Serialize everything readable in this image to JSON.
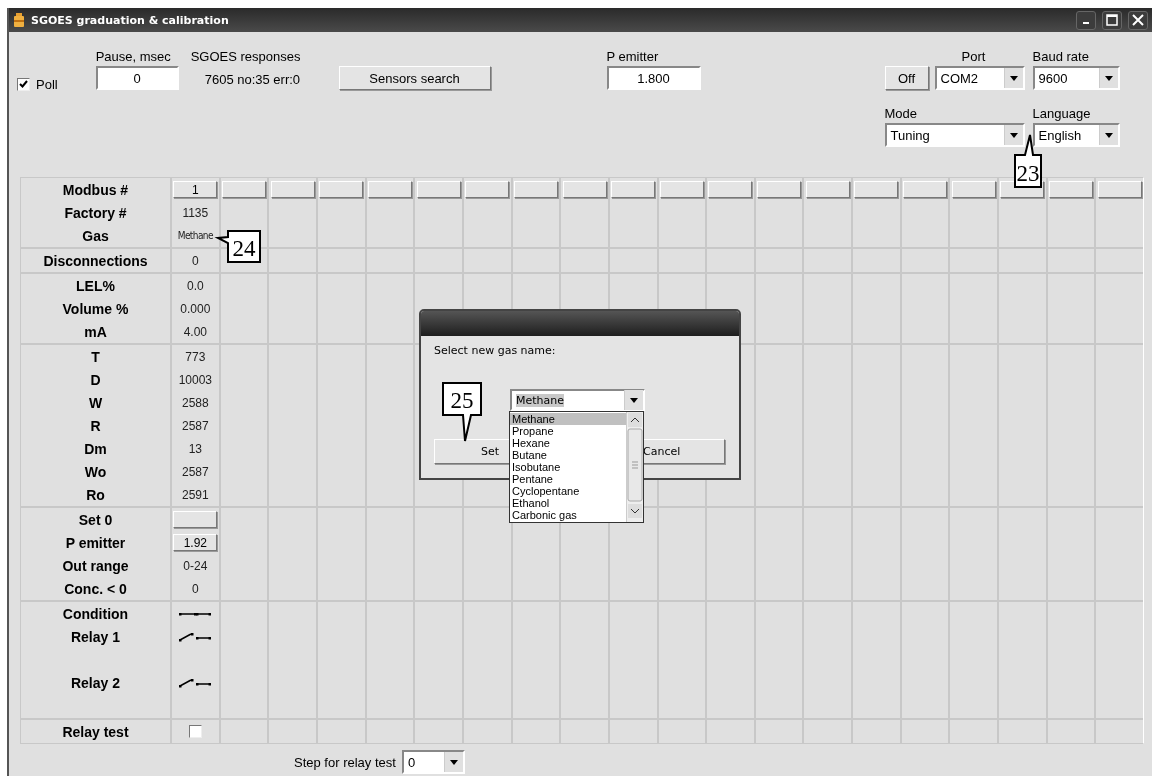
{
  "window": {
    "title": "SGOES  graduation & calibration"
  },
  "top": {
    "poll": {
      "label": "Poll",
      "checked": true
    },
    "pause": {
      "label": "Pause, msec",
      "value": "0"
    },
    "responses": {
      "label": "SGOES responses",
      "value": "7605 no:35 err:0"
    },
    "search_button": "Sensors search",
    "p_emitter": {
      "label": "P emitter",
      "value": "1.800"
    },
    "port": {
      "label": "Port",
      "off_button": "Off",
      "value": "COM2"
    },
    "baud": {
      "label": "Baud rate",
      "value": "9600"
    },
    "mode": {
      "label": "Mode",
      "value": "Tuning"
    },
    "language": {
      "label": "Language",
      "value": "English"
    }
  },
  "table": {
    "groups": [
      {
        "kind": "plain",
        "rows": [
          {
            "label": "Modbus #",
            "kind": "header-button",
            "value": "1"
          },
          {
            "label": "Factory #",
            "kind": "text",
            "value": "1135"
          },
          {
            "label": "Gas",
            "kind": "small-text",
            "value": "Methane"
          }
        ]
      },
      {
        "kind": "plain",
        "rows": [
          {
            "label": "Disconnections",
            "kind": "text",
            "value": "0"
          }
        ]
      },
      {
        "kind": "plain",
        "rows": [
          {
            "label": "LEL%",
            "kind": "text",
            "value": "0.0"
          },
          {
            "label": "Volume %",
            "kind": "text",
            "value": "0.000"
          },
          {
            "label": "mA",
            "kind": "text",
            "value": "4.00"
          }
        ]
      },
      {
        "kind": "plain",
        "rows": [
          {
            "label": "T",
            "kind": "text",
            "value": "773"
          },
          {
            "label": "D",
            "kind": "text",
            "value": "10003"
          },
          {
            "label": "W",
            "kind": "text",
            "value": "2588"
          },
          {
            "label": "R",
            "kind": "text",
            "value": "2587"
          },
          {
            "label": "Dm",
            "kind": "text",
            "value": "13"
          },
          {
            "label": "Wo",
            "kind": "text",
            "value": "2587"
          },
          {
            "label": "Ro",
            "kind": "text",
            "value": "2591"
          }
        ]
      },
      {
        "kind": "plain",
        "rows": [
          {
            "label": "Set 0",
            "kind": "blank-button"
          },
          {
            "label": "P emitter",
            "kind": "value-button",
            "value": "1.92"
          },
          {
            "label": "Out range",
            "kind": "text",
            "value": "0-24"
          },
          {
            "label": "Conc. < 0",
            "kind": "text",
            "value": "0"
          }
        ]
      },
      {
        "kind": "relays",
        "rows": [
          {
            "label": "Condition",
            "kind": "switch",
            "closed": true
          },
          {
            "label": "Relay 1",
            "kind": "switch",
            "closed": false
          },
          {
            "label": "Relay 2",
            "kind": "switch",
            "closed": false
          }
        ]
      },
      {
        "kind": "plain",
        "rows": [
          {
            "label": "Relay test",
            "kind": "checkbox",
            "checked": false
          }
        ]
      }
    ]
  },
  "step": {
    "label": "Step for relay test",
    "value": "0"
  },
  "dialog": {
    "label": "Select new gas name:",
    "value": "Methane",
    "set_button": "Set",
    "cancel_button": "Cancel",
    "options": [
      {
        "label": "Methane",
        "selected": true
      },
      {
        "label": "Propane",
        "selected": false
      },
      {
        "label": "Hexane",
        "selected": false
      },
      {
        "label": "Butane",
        "selected": false
      },
      {
        "label": "Isobutane",
        "selected": false
      },
      {
        "label": "Pentane",
        "selected": false
      },
      {
        "label": "Cyclopentane",
        "selected": false
      },
      {
        "label": "Ethanol",
        "selected": false
      },
      {
        "label": "Carbonic gas",
        "selected": false
      }
    ]
  },
  "callouts": [
    {
      "text": "23",
      "kind": "up"
    },
    {
      "text": "24",
      "kind": "left"
    },
    {
      "text": "25",
      "kind": "down"
    }
  ]
}
